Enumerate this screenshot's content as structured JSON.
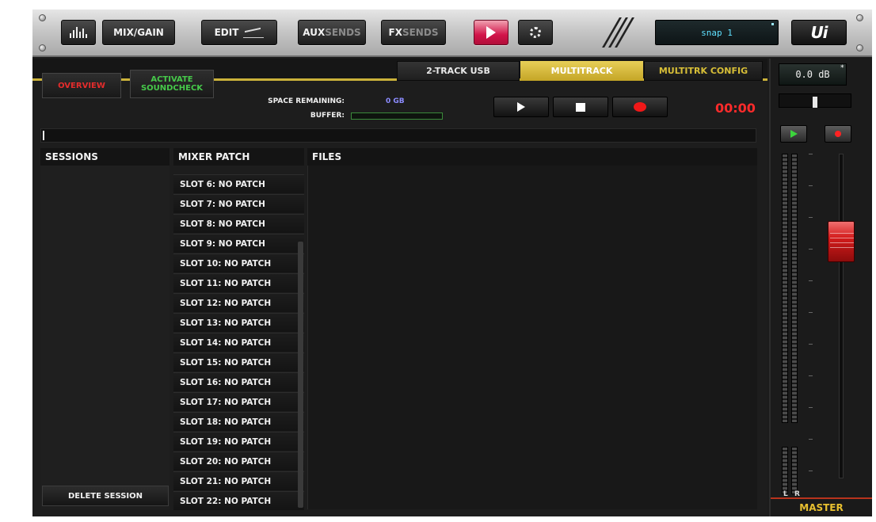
{
  "toolbar": {
    "mix_gain_label": "MIX/GAIN",
    "edit_label": "EDIT",
    "aux_label_a": "AUX",
    "aux_label_b": "SENDS",
    "fx_label_a": "FX",
    "fx_label_b": "SENDS",
    "snapshot_name": "snap 1",
    "logo": "Ui"
  },
  "tabs": [
    {
      "label": "2-TRACK USB",
      "active": false
    },
    {
      "label": "MULTITRACK",
      "active": true
    },
    {
      "label": "MULTITRK CONFIG",
      "active": false
    }
  ],
  "controls": {
    "overview_label": "OVERVIEW",
    "activate_soundcheck_line1": "ACTIVATE",
    "activate_soundcheck_line2": "SOUNDCHECK",
    "space_remaining_label": "SPACE REMAINING:",
    "space_remaining_value": "0 GB",
    "buffer_label": "BUFFER:",
    "buffer_level": 0,
    "timer": "00:00"
  },
  "columns": {
    "sessions_header": "SESSIONS",
    "mixer_patch_header": "MIXER PATCH",
    "files_header": "FILES",
    "delete_session_label": "DELETE SESSION"
  },
  "mixer_patch": [
    "SLOT 6: NO PATCH",
    "SLOT 7: NO PATCH",
    "SLOT 8: NO PATCH",
    "SLOT 9: NO PATCH",
    "SLOT 10: NO PATCH",
    "SLOT 11: NO PATCH",
    "SLOT 12: NO PATCH",
    "SLOT 13: NO PATCH",
    "SLOT 14: NO PATCH",
    "SLOT 15: NO PATCH",
    "SLOT 16: NO PATCH",
    "SLOT 17: NO PATCH",
    "SLOT 18: NO PATCH",
    "SLOT 19: NO PATCH",
    "SLOT 20: NO PATCH",
    "SLOT 21: NO PATCH",
    "SLOT 22: NO PATCH"
  ],
  "master": {
    "db_readout": "0.0 dB",
    "left_label": "L",
    "right_label": "R",
    "strip_label": "MASTER"
  },
  "colors": {
    "accent_gold": "#cbb23a",
    "record_red": "#f01818",
    "soundcheck_green": "#46c94a",
    "overview_red": "#e52c2c"
  }
}
